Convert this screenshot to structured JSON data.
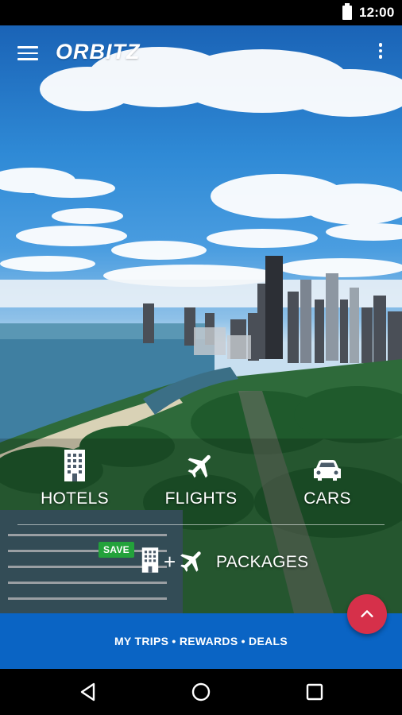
{
  "status_bar": {
    "time": "12:00"
  },
  "app_bar": {
    "logo_text": "ORBITZ"
  },
  "products": {
    "hotels": "HOTELS",
    "flights": "FLIGHTS",
    "cars": "CARS"
  },
  "packages": {
    "badge": "SAVE",
    "plus": "+",
    "label": "PACKAGES"
  },
  "bottom_bar": {
    "label": "MY TRIPS • REWARDS • DEALS"
  },
  "colors": {
    "bottom_bar_bg": "#0a64c4",
    "fab_bg": "#d6304a",
    "save_badge_bg": "#23a23b",
    "text": "#ffffff"
  },
  "icons": {
    "menu": "hamburger-menu-icon",
    "overflow": "more-vert-icon",
    "hotels": "building-icon",
    "flights": "airplane-icon",
    "cars": "car-icon",
    "fab": "chevron-up-icon",
    "nav_back": "triangle-back-icon",
    "nav_home": "circle-home-icon",
    "nav_recents": "square-recents-icon"
  }
}
